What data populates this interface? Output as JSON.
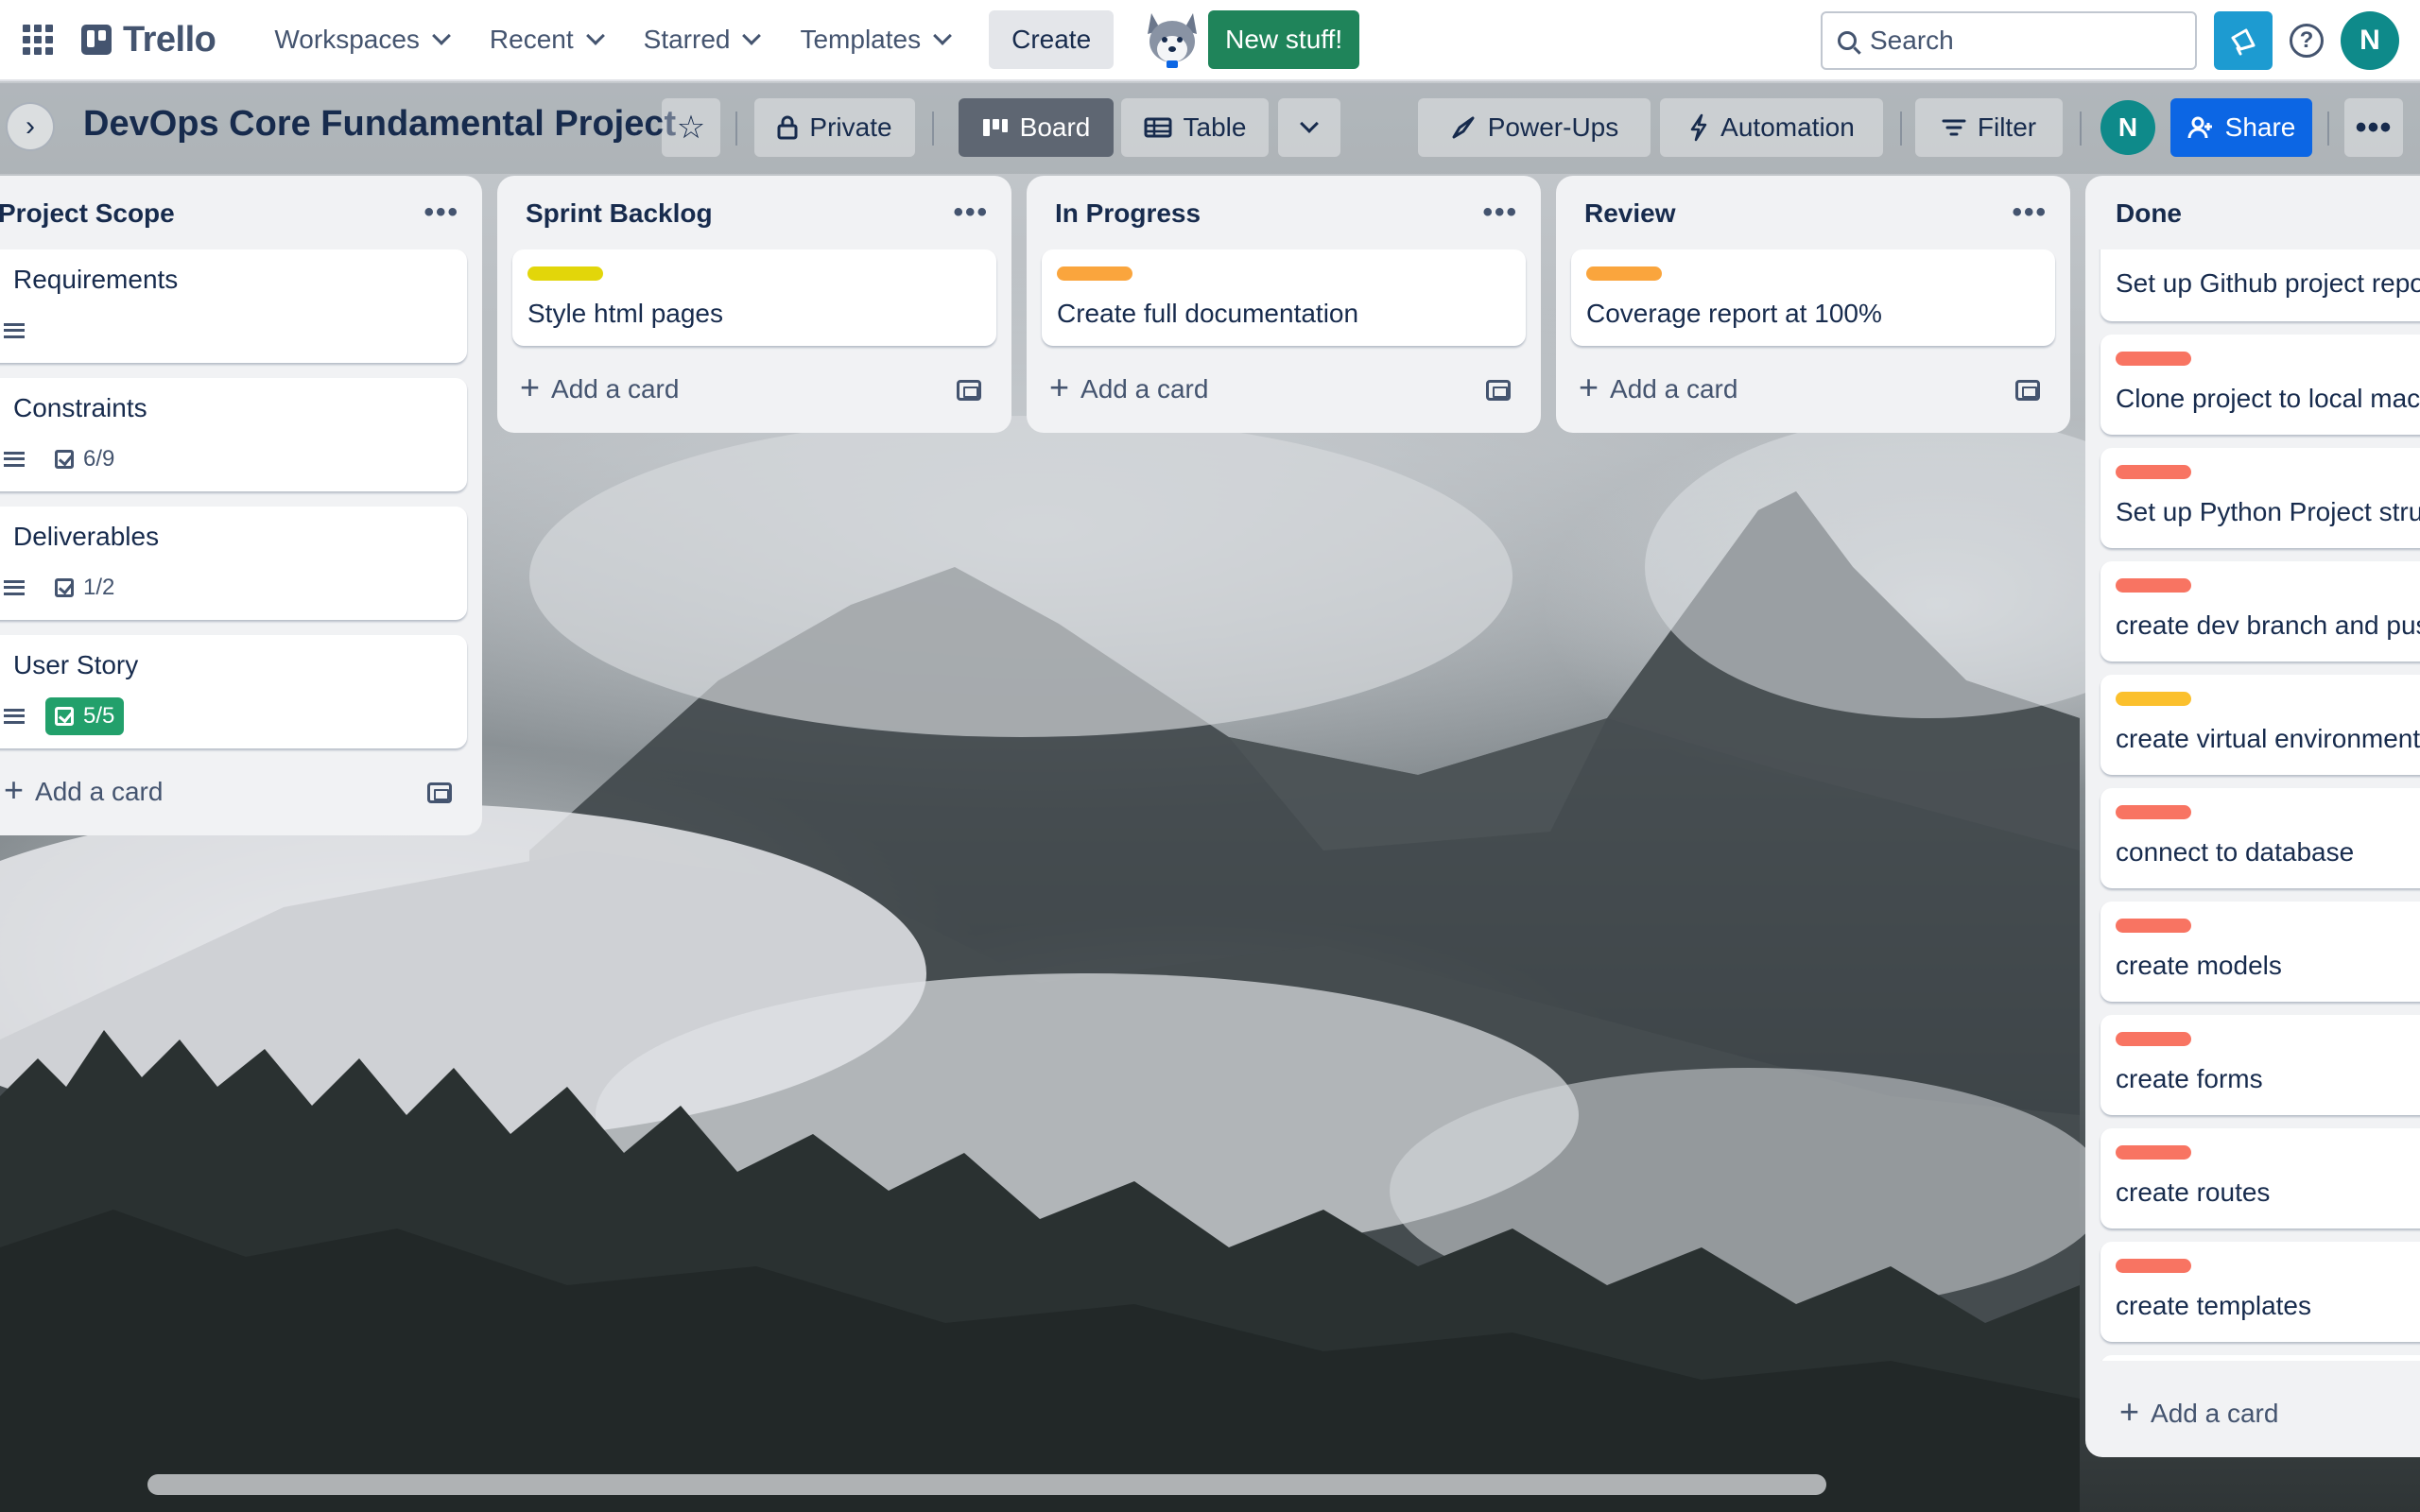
{
  "colors": {
    "label_red": "#f87462",
    "label_yellow": "#e2b203",
    "label_orange": "#faa53d",
    "brand": "#44546f",
    "share": "#0c66e4",
    "new_stuff": "#1f845a",
    "complete": "#22a06b"
  },
  "topbar": {
    "logo": "Trello",
    "nav": [
      {
        "label": "Workspaces"
      },
      {
        "label": "Recent"
      },
      {
        "label": "Starred"
      },
      {
        "label": "Templates"
      }
    ],
    "create": "Create",
    "new_stuff": "New stuff!",
    "search_placeholder": "Search",
    "avatar": "N"
  },
  "board": {
    "title": "DevOps Core Fundamental Project",
    "visibility": "Private",
    "views": {
      "board": "Board",
      "table": "Table"
    },
    "power_ups": "Power-Ups",
    "automation": "Automation",
    "filter": "Filter",
    "member_avatar": "N",
    "share": "Share"
  },
  "lists": [
    {
      "title": "Project Scope",
      "cards": [
        {
          "title": "Requirements",
          "description": true
        },
        {
          "title": "Constraints",
          "description": true,
          "checklist": "6/9"
        },
        {
          "title": "Deliverables",
          "description": true,
          "checklist": "1/2"
        },
        {
          "title": "User Story",
          "description": true,
          "checklist": "5/5",
          "complete": true
        }
      ],
      "add_card": "Add a card"
    },
    {
      "title": "Sprint Backlog",
      "cards": [
        {
          "title": "Style html pages",
          "label": "yellow"
        }
      ],
      "add_card": "Add a card"
    },
    {
      "title": "In Progress",
      "cards": [
        {
          "title": "Create full documentation",
          "label": "orange"
        }
      ],
      "add_card": "Add a card"
    },
    {
      "title": "Review",
      "cards": [
        {
          "title": "Coverage report at 100%",
          "label": "orange"
        }
      ],
      "add_card": "Add a card"
    },
    {
      "title": "Done",
      "cards": [
        {
          "title": "Set up Github project repo",
          "label": "red"
        },
        {
          "title": "Clone project to local mac",
          "label": "red"
        },
        {
          "title": "Set up Python Project stru",
          "label": "red"
        },
        {
          "title": "create dev branch and pus",
          "label": "red"
        },
        {
          "title": "create virtual environment",
          "label": "yellow"
        },
        {
          "title": "connect to database",
          "label": "red"
        },
        {
          "title": "create models",
          "label": "red"
        },
        {
          "title": "create forms",
          "label": "red"
        },
        {
          "title": "create routes",
          "label": "red"
        },
        {
          "title": "create templates",
          "label": "red"
        }
      ],
      "add_card": "Add a card"
    }
  ]
}
